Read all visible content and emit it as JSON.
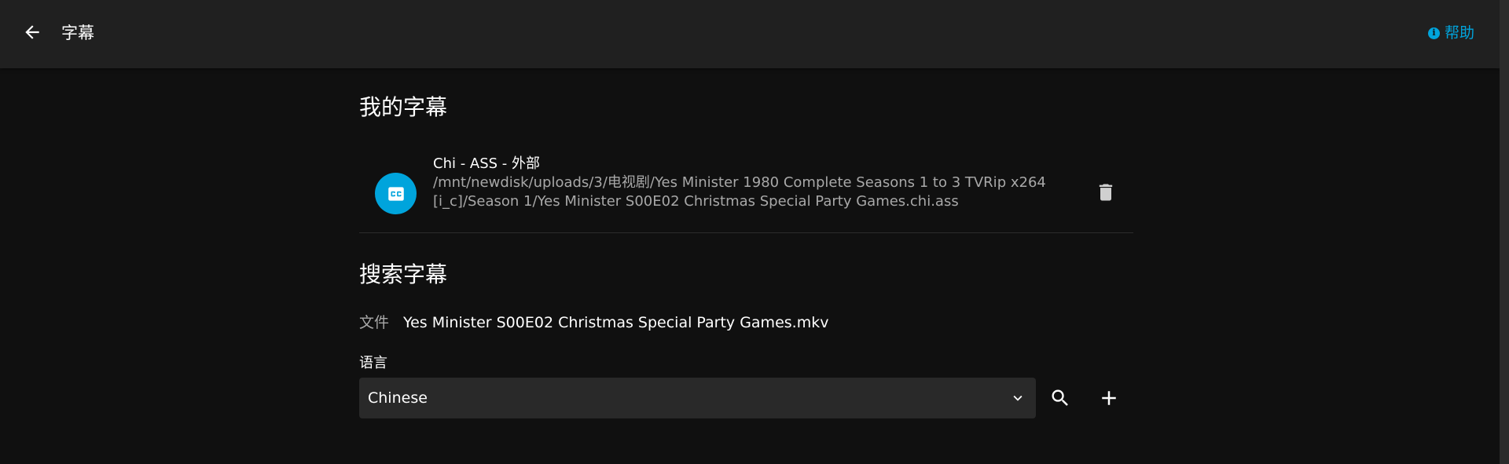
{
  "header": {
    "title": "字幕",
    "help_label": "帮助",
    "help_icon_glyph": "i"
  },
  "my_subtitles": {
    "section_title": "我的字幕",
    "items": [
      {
        "name": "Chi - ASS - 外部",
        "path": "/mnt/newdisk/uploads/3/电视剧/Yes Minister 1980 Complete Seasons 1 to 3 TVRip x264 [i_c]/Season 1/Yes Minister S00E02 Christmas Special Party Games.chi.ass",
        "icon": "closed-captions-icon"
      }
    ]
  },
  "search_subtitles": {
    "section_title": "搜索字幕",
    "file_label": "文件",
    "file_value": "Yes Minister S00E02 Christmas Special Party Games.mkv",
    "language_label": "语言",
    "language_selected": "Chinese"
  },
  "colors": {
    "accent": "#00a4dc",
    "background": "#101010",
    "header": "#202020",
    "select_bg": "#292929",
    "secondary_text": "#a8a8a8"
  }
}
